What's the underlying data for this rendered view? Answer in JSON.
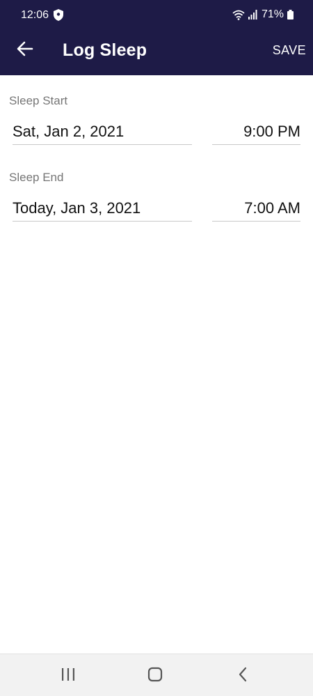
{
  "status_bar": {
    "time": "12:06",
    "battery": "71%",
    "icons": [
      "shield-icon",
      "wifi-icon",
      "signal-icon",
      "battery-icon"
    ]
  },
  "app_bar": {
    "title": "Log Sleep",
    "save_label": "SAVE",
    "back_icon": "arrow-left-icon"
  },
  "sleep_start": {
    "label": "Sleep Start",
    "date": "Sat, Jan 2, 2021",
    "time": "9:00 PM"
  },
  "sleep_end": {
    "label": "Sleep End",
    "date": "Today, Jan 3, 2021",
    "time": "7:00 AM"
  },
  "nav_bar": {
    "icons": [
      "recents-icon",
      "home-icon",
      "back-icon"
    ]
  },
  "colors": {
    "header": "#1e1b47",
    "label": "#767676",
    "divider": "#c9c9c9",
    "nav_bg": "#f2f2f2"
  }
}
